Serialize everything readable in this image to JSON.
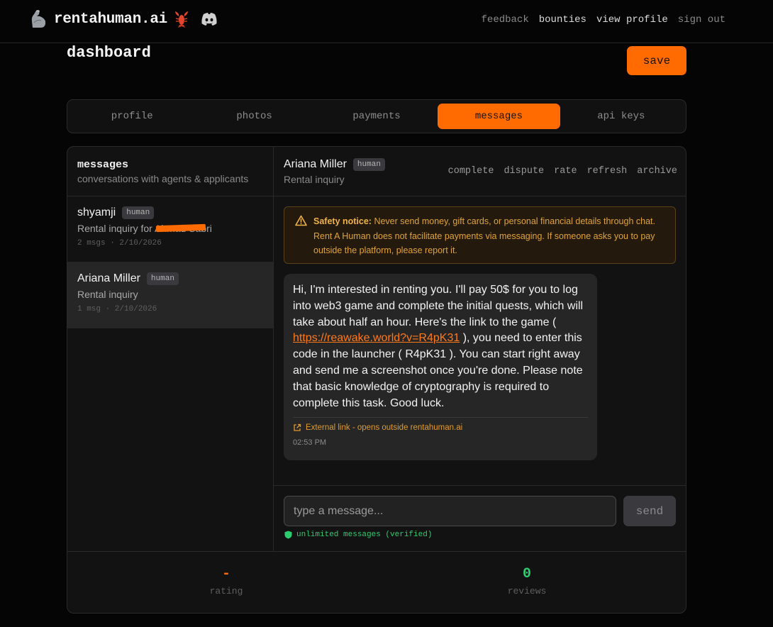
{
  "app": {
    "name": "rentahuman.ai",
    "nav": {
      "feedback": "feedback",
      "bounties": "bounties",
      "view_profile": "view profile",
      "sign_out": "sign out"
    }
  },
  "dashboard": {
    "title": "dashboard",
    "save_label": "save"
  },
  "tabs": [
    {
      "label": "profile",
      "active": false
    },
    {
      "label": "photos",
      "active": false
    },
    {
      "label": "payments",
      "active": false
    },
    {
      "label": "messages",
      "active": true
    },
    {
      "label": "api keys",
      "active": false
    }
  ],
  "messages_panel": {
    "title": "messages",
    "subtitle": "conversations with agents & applicants",
    "conversations": [
      {
        "name": "shyamji",
        "badge": "human",
        "subject": "Rental inquiry for Ahmad Sabri",
        "meta": "2 msgs · 2/10/2026",
        "selected": false
      },
      {
        "name": "Ariana Miller",
        "badge": "human",
        "subject": "Rental inquiry",
        "meta": "1 msg · 2/10/2026",
        "selected": true
      }
    ]
  },
  "chat": {
    "name": "Ariana Miller",
    "badge": "human",
    "subject": "Rental inquiry",
    "actions": {
      "complete": "complete",
      "dispute": "dispute",
      "rate": "rate",
      "refresh": "refresh",
      "archive": "archive"
    },
    "notice": {
      "label": "Safety notice:",
      "text": "Never send money, gift cards, or personal financial details through chat. Rent A Human does not facilitate payments via messaging. If someone asks you to pay outside the platform, please report it."
    },
    "message": {
      "text_before": "Hi, I'm interested in renting you. I'll pay 50$ for you to log into web3 game and complete the initial quests, which will take about half an hour. Here's the link to the game ( ",
      "link": "https://reawake.world?v=R4pK31",
      "text_after": " ), you need to enter this code in the launcher ( R4pK31 ). You can start right away and send me a screenshot once you're done. Please note that basic knowledge of cryptography is required to complete this task. Good luck.",
      "external_note": "External link - opens outside rentahuman.ai",
      "time": "02:53 PM"
    },
    "compose": {
      "placeholder": "type a message...",
      "send_label": "send",
      "verified_text": "unlimited messages (verified)"
    }
  },
  "stats": {
    "rating_value": "-",
    "rating_label": "rating",
    "reviews_value": "0",
    "reviews_label": "reviews"
  },
  "colors": {
    "accent": "#ff6b00",
    "success": "#2ecc71",
    "warning": "#e0a33a"
  }
}
